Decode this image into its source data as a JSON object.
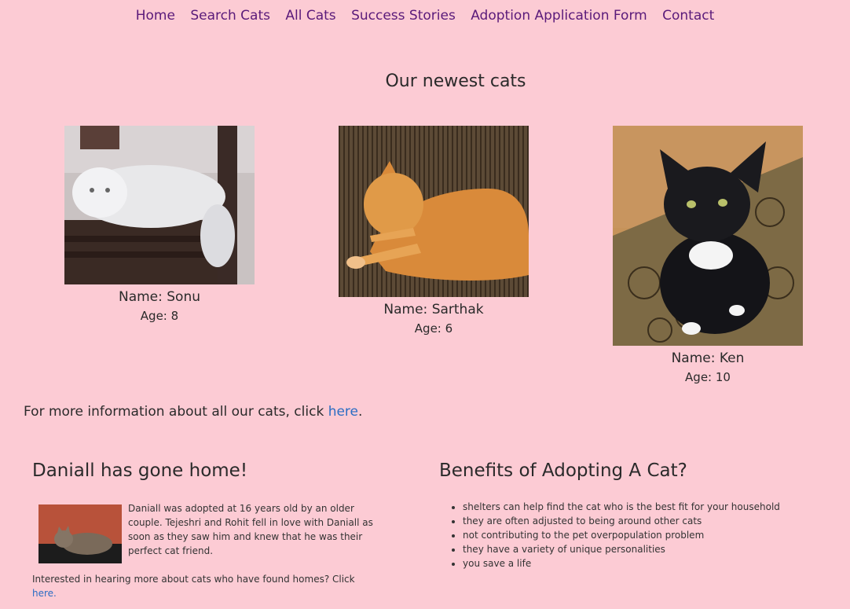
{
  "nav": {
    "items": [
      "Home",
      "Search Cats",
      "All Cats",
      "Success Stories",
      "Adoption Application Form",
      "Contact"
    ]
  },
  "newest": {
    "title": "Our newest cats",
    "cats": [
      {
        "name": "Name: Sonu",
        "age": "Age: 8"
      },
      {
        "name": "Name: Sarthak",
        "age": "Age: 6"
      },
      {
        "name": "Name: Ken",
        "age": "Age: 10"
      }
    ]
  },
  "more_info": {
    "text": "For more information about all our cats, click ",
    "link": "here",
    "end": "."
  },
  "story": {
    "title": "Daniall has gone home!",
    "paragraph1": "Daniall was adopted at 16 years old by an older couple. Tejeshri and Rohit fell in love with Daniall as soon as they saw him and knew that he was their perfect cat friend.",
    "paragraph2": "Interested in hearing more about cats who have found homes? Click ",
    "link": "here."
  },
  "benefits": {
    "title": "Benefits of Adopting A Cat?",
    "items": [
      "shelters can help find the cat who is the best fit for your household",
      "they are often adjusted to being around other cats",
      "not contributing to the pet overpopulation problem",
      "they have a variety of unique personalities",
      "you save a life"
    ]
  }
}
